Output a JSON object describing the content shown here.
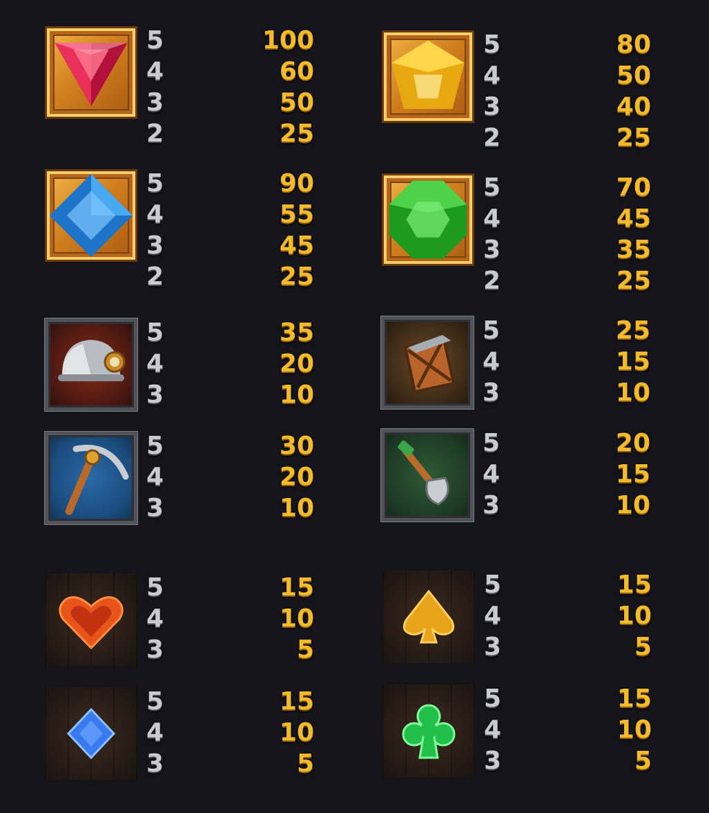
{
  "colors": {
    "background": "#16141b",
    "count_text": "#c9cbd0",
    "pay_text": "#f1bb2d"
  },
  "entries": [
    {
      "symbol": "red-triangle-gem-icon",
      "counts": [
        "5",
        "4",
        "3",
        "2"
      ],
      "pays": [
        "100",
        "60",
        "50",
        "25"
      ]
    },
    {
      "symbol": "yellow-pentagon-gem-icon",
      "counts": [
        "5",
        "4",
        "3",
        "2"
      ],
      "pays": [
        "80",
        "50",
        "40",
        "25"
      ]
    },
    {
      "symbol": "blue-diamond-gem-icon",
      "counts": [
        "5",
        "4",
        "3",
        "2"
      ],
      "pays": [
        "90",
        "55",
        "45",
        "25"
      ]
    },
    {
      "symbol": "green-octagon-gem-icon",
      "counts": [
        "5",
        "4",
        "3",
        "2"
      ],
      "pays": [
        "70",
        "45",
        "35",
        "25"
      ]
    },
    {
      "symbol": "miner-helmet-icon",
      "counts": [
        "5",
        "4",
        "3"
      ],
      "pays": [
        "35",
        "20",
        "10"
      ]
    },
    {
      "symbol": "lantern-icon",
      "counts": [
        "5",
        "4",
        "3"
      ],
      "pays": [
        "25",
        "15",
        "10"
      ]
    },
    {
      "symbol": "pickaxe-icon",
      "counts": [
        "5",
        "4",
        "3"
      ],
      "pays": [
        "30",
        "20",
        "10"
      ]
    },
    {
      "symbol": "shovel-icon",
      "counts": [
        "5",
        "4",
        "3"
      ],
      "pays": [
        "20",
        "15",
        "10"
      ]
    },
    {
      "symbol": "heart-icon",
      "counts": [
        "5",
        "4",
        "3"
      ],
      "pays": [
        "15",
        "10",
        "5"
      ]
    },
    {
      "symbol": "spade-icon",
      "counts": [
        "5",
        "4",
        "3"
      ],
      "pays": [
        "15",
        "10",
        "5"
      ]
    },
    {
      "symbol": "diamond-suit-icon",
      "counts": [
        "5",
        "4",
        "3"
      ],
      "pays": [
        "15",
        "10",
        "5"
      ]
    },
    {
      "symbol": "club-icon",
      "counts": [
        "5",
        "4",
        "3"
      ],
      "pays": [
        "15",
        "10",
        "5"
      ]
    }
  ]
}
